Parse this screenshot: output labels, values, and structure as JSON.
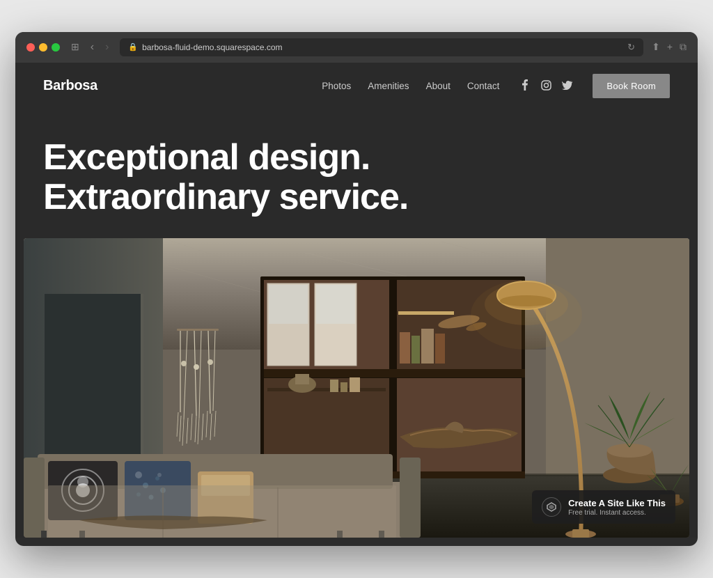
{
  "browser": {
    "url": "barbosa-fluid-demo.squarespace.com",
    "traffic_lights": [
      "red",
      "yellow",
      "green"
    ],
    "back_arrow": "‹",
    "forward_arrow": "›",
    "sidebar_icon": "⊞",
    "refresh_icon": "↻",
    "share_icon": "⬆",
    "new_tab_icon": "+",
    "copy_icon": "⧉"
  },
  "nav": {
    "logo": "Barbosa",
    "links": [
      {
        "label": "Photos",
        "id": "photos"
      },
      {
        "label": "Amenities",
        "id": "amenities"
      },
      {
        "label": "About",
        "id": "about"
      },
      {
        "label": "Contact",
        "id": "contact"
      }
    ],
    "social": [
      {
        "name": "facebook-icon",
        "symbol": "f"
      },
      {
        "name": "instagram-icon",
        "symbol": "◎"
      },
      {
        "name": "twitter-icon",
        "symbol": "𝕏"
      }
    ],
    "book_button": "Book Room"
  },
  "hero": {
    "headline_line1": "Exceptional design.",
    "headline_line2": "Extraordinary service."
  },
  "badge": {
    "icon_symbol": "◈",
    "main_text": "Create A Site Like This",
    "sub_text": "Free trial. Instant access."
  }
}
